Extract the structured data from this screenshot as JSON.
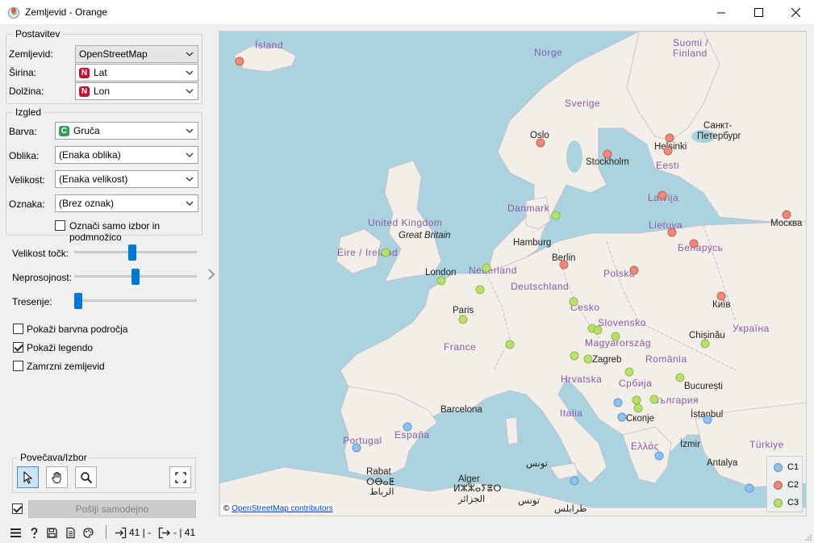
{
  "window": {
    "title": "Zemljevid - Orange"
  },
  "placement": {
    "title": "Postavitev",
    "map_label": "Zemljevid:",
    "map_value": "OpenStreetMap",
    "lat_label": "Širina:",
    "lat_value": "Lat",
    "lat_badge": "N",
    "lon_label": "Dolžina:",
    "lon_value": "Lon",
    "lon_badge": "N"
  },
  "appearance": {
    "title": "Izgled",
    "color_label": "Barva:",
    "color_value": "Gruča",
    "color_badge": "C",
    "shape_label": "Oblika:",
    "shape_value": "(Enaka oblika)",
    "size_label": "Velikost:",
    "size_value": "(Enaka velikost)",
    "label_label": "Oznaka:",
    "label_value": "(Brez oznak)",
    "label_selected_only": "Označi samo izbor in podmnožico",
    "label_selected_only_checked": false
  },
  "sliders": {
    "point_size_label": "Velikost točk:",
    "point_size_level": 0.47,
    "opacity_label": "Neprosojnost:",
    "opacity_level": 0.5,
    "jitter_label": "Tresenje:",
    "jitter_level": 0.0
  },
  "options": {
    "show_color_regions": "Pokaži barvna področja",
    "show_color_regions_checked": false,
    "show_legend": "Pokaži legendo",
    "show_legend_checked": true,
    "freeze_map": "Zamrzni zemljevid",
    "freeze_map_checked": false
  },
  "zoom": {
    "title": "Povečava/Izbor"
  },
  "send": {
    "label": "Pošlji samodejno",
    "auto_checked": true
  },
  "status": {
    "input_count": "41 | -",
    "output_count": "- | 41"
  },
  "colors": {
    "C1": "#8fc3ef",
    "C2": "#ef8a7a",
    "C3": "#b9e06a",
    "accent": "#0078d7"
  },
  "map": {
    "attribution_symbol": "©",
    "attribution_link": "OpenStreetMap contributors",
    "legend": [
      {
        "label": "C1",
        "color": "#8fc3ef"
      },
      {
        "label": "C2",
        "color": "#ef8a7a"
      },
      {
        "label": "C3",
        "color": "#b9e06a"
      }
    ],
    "labels": {
      "island": "Ísland",
      "norge": "Norge",
      "sverige": "Sverige",
      "suomi": "Suomi /",
      "finland": "Finland",
      "oslo": "Oslo",
      "stockholm": "Stockholm",
      "helsinki": "Helsinki",
      "spb1": "Санкт-",
      "spb2": "Петербург",
      "eesti": "Eesti",
      "latvija": "Latvija",
      "lietuva": "Lietuva",
      "moskva": "Москва",
      "danmark": "Danmark",
      "uk": "United Kingdom",
      "gb": "Great Britain",
      "ireland": "Éire / Ireland",
      "london": "London",
      "hamburg": "Hamburg",
      "berlin": "Berlin",
      "nederland": "Nederland",
      "deutschland": "Deutschland",
      "polska": "Polska",
      "belarus": "Беларусь",
      "kyiv": "Київ",
      "paris": "Paris",
      "cesko": "Česko",
      "slovensko": "Slovensko",
      "magyar": "Magyarország",
      "chisinau": "Chișinău",
      "ukraina": "Україна",
      "france": "France",
      "zagreb": "Zagreb",
      "romania": "România",
      "hrvatska": "Hrvatska",
      "srbija": "Србија",
      "bucuresti": "București",
      "bulgaria": "България",
      "barcelona": "Barcelona",
      "italia": "Italia",
      "skopje": "Скопје",
      "istanbul": "İstanbul",
      "portugal": "Portugal",
      "espana": "España",
      "ellas": "Ελλάς",
      "izmir": "İzmir",
      "turkiye": "Türkiye",
      "antalya": "Antalya",
      "rabat1": "Rabat",
      "rabat2": "ⵔⴱⴰⵟ",
      "rabat3": "الرباط",
      "alger1": "Alger",
      "alger2": "ⵍⵣⵣⴰⵢⴻⵔ",
      "alger3": "الجزائر",
      "tunis1": "تونس",
      "tunis2": "تونس",
      "tripoli": "طرابلس"
    }
  }
}
